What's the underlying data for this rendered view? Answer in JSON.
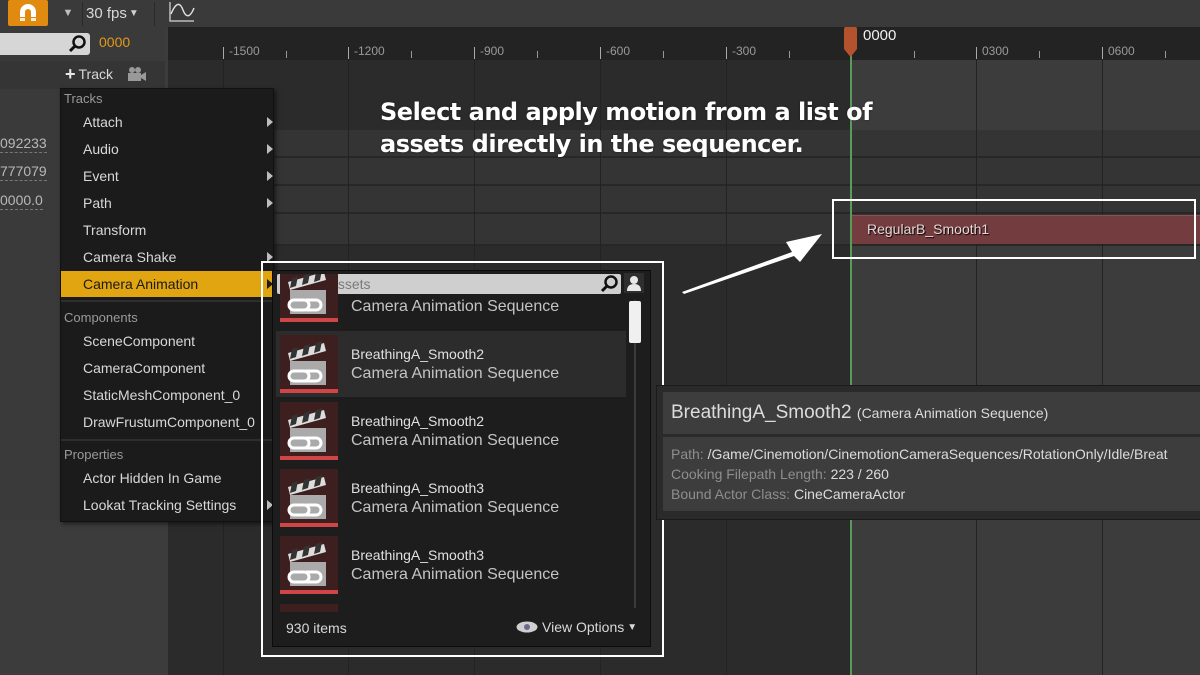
{
  "toolbar": {
    "snap_icon": "magnet-icon",
    "frame_rate": "30 fps",
    "curve_editor_icon": "curve-icon"
  },
  "left_panel": {
    "search_placeholder": "",
    "current_frame": "0000",
    "add_track_label": "Track",
    "values": [
      "092233",
      "777079",
      "0000.0"
    ]
  },
  "timeline": {
    "ruler_ticks": [
      "-1500",
      "-1200",
      "-900",
      "-600",
      "-300",
      "0300",
      "0600"
    ],
    "playhead_frame": "0000",
    "section_clip_label": "RegularB_Smooth1"
  },
  "annotation": {
    "headline_line1": "Select and apply motion from a list of",
    "headline_line2": "assets directly in the sequencer."
  },
  "context_menu": {
    "sections": [
      {
        "header": "Tracks",
        "items": [
          {
            "label": "Attach",
            "submenu": true
          },
          {
            "label": "Audio",
            "submenu": true
          },
          {
            "label": "Event",
            "submenu": true
          },
          {
            "label": "Path",
            "submenu": true
          },
          {
            "label": "Transform",
            "submenu": false
          },
          {
            "label": "Camera Shake",
            "submenu": true
          },
          {
            "label": "Camera Animation",
            "submenu": true,
            "active": true
          }
        ]
      },
      {
        "header": "Components",
        "items": [
          {
            "label": "SceneComponent"
          },
          {
            "label": "CameraComponent"
          },
          {
            "label": "StaticMeshComponent_0"
          },
          {
            "label": "DrawFrustumComponent_0"
          }
        ]
      },
      {
        "header": "Properties",
        "items": [
          {
            "label": "Actor Hidden In Game"
          },
          {
            "label": "Lookat Tracking Settings",
            "submenu": true
          }
        ]
      }
    ]
  },
  "asset_picker": {
    "search_placeholder": "Search Assets",
    "assets": [
      {
        "name": "",
        "type": "Camera Animation Sequence"
      },
      {
        "name": "BreathingA_Smooth2",
        "type": "Camera Animation Sequence",
        "highlighted": true
      },
      {
        "name": "BreathingA_Smooth2",
        "type": "Camera Animation Sequence"
      },
      {
        "name": "BreathingA_Smooth3",
        "type": "Camera Animation Sequence"
      },
      {
        "name": "BreathingA_Smooth3",
        "type": "Camera Animation Sequence"
      }
    ],
    "item_count": "930 items",
    "view_options_label": "View Options"
  },
  "tooltip": {
    "asset_name": "BreathingA_Smooth2",
    "asset_type": "(Camera Animation Sequence)",
    "path_label": "Path:",
    "path_value": "/Game/Cinemotion/CinemotionCameraSequences/RotationOnly/Idle/Breat",
    "cooking_label": "Cooking Filepath Length:",
    "cooking_value": "223 / 260",
    "bound_label": "Bound Actor Class:",
    "bound_value": "CineCameraActor"
  },
  "colors": {
    "accent_orange": "#e08a10",
    "menu_active": "#e2a512",
    "clip_red": "#733d40",
    "playhead_green": "#5a9a5a",
    "frame_number_orange": "#e39a1a"
  }
}
